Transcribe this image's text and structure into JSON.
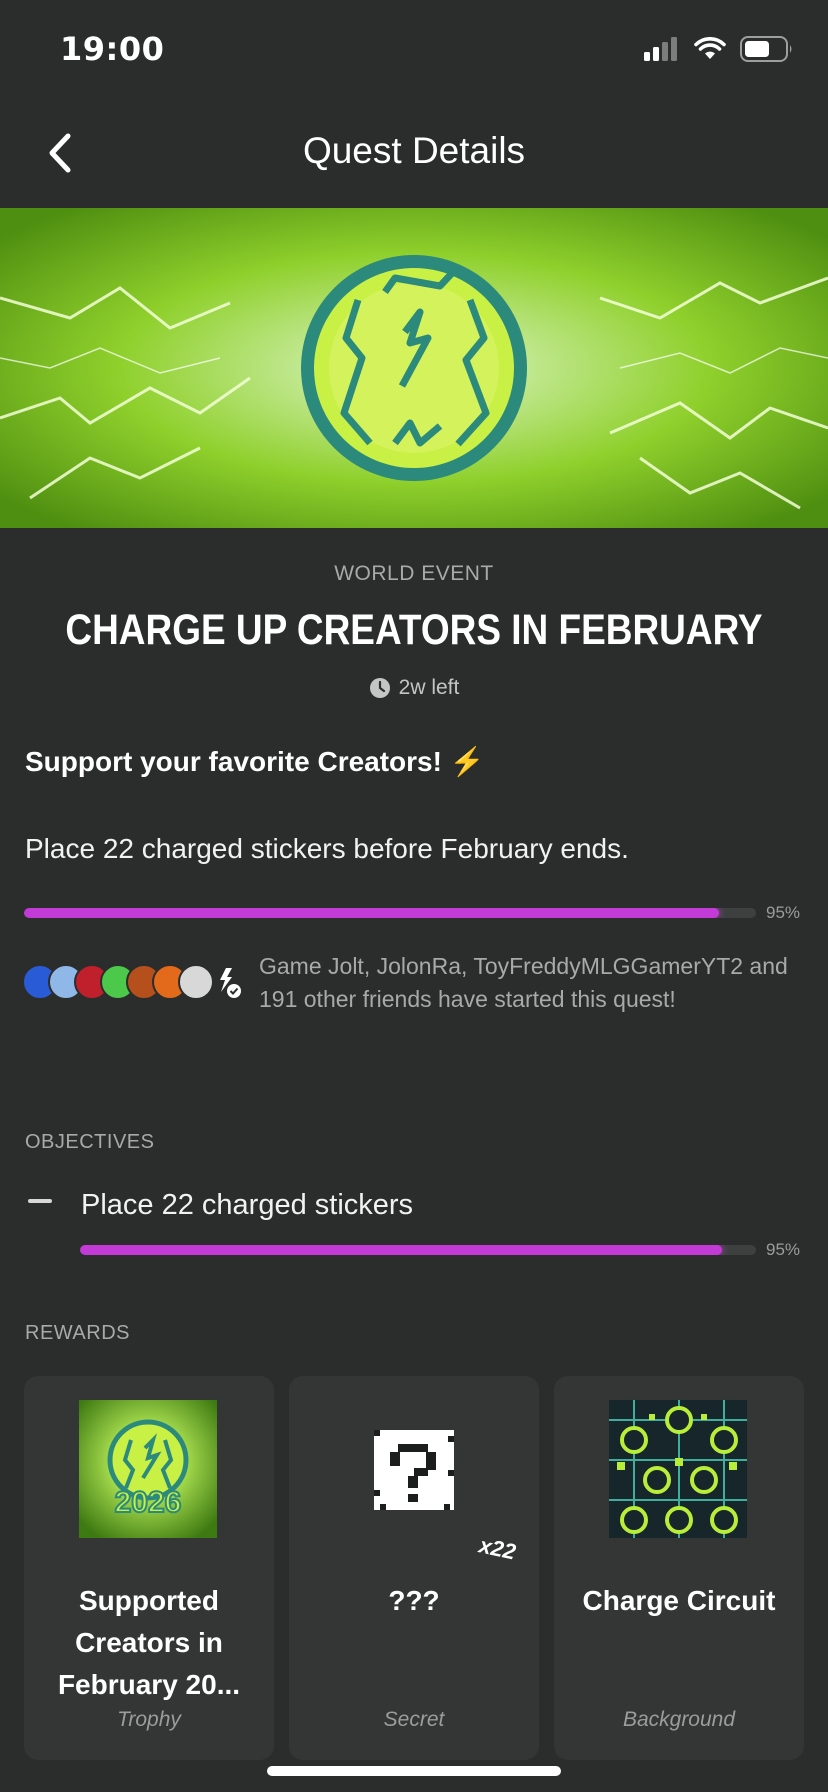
{
  "status_bar": {
    "time": "19:00",
    "signal_icon": "signal-icon",
    "wifi_icon": "wifi-icon",
    "battery_icon": "battery-icon"
  },
  "nav": {
    "back_icon": "chevron-left-icon",
    "title": "Quest Details"
  },
  "quest": {
    "event_type": "WORLD EVENT",
    "title": "CHARGE UP CREATORS IN FEBRUARY",
    "time_left": "2w left",
    "subtitle": "Support your favorite Creators! ⚡",
    "description": "Place 22 charged stickers before February ends.",
    "progress": 0.95,
    "progress_label": "95%"
  },
  "friends": {
    "text": "Game Jolt, JolonRa, ToyFreddyMLGGamerYT2 and 191 other friends have started this quest!",
    "avatar_colors": [
      "#2a5bd7",
      "#8fb8e8",
      "#c0202b",
      "#4cc94a",
      "#b5501d",
      "#e36a1b",
      "#d8d8d8",
      "#20242a"
    ]
  },
  "objectives": {
    "label": "OBJECTIVES",
    "items": [
      {
        "label": "Place 22 charged stickers",
        "progress": 0.95,
        "progress_label": "95%"
      }
    ]
  },
  "rewards": {
    "label": "REWARDS",
    "items": [
      {
        "name": "Supported Creators in February 20...",
        "kind": "Trophy",
        "image_text": "2026"
      },
      {
        "name": "???",
        "kind": "Secret",
        "multiplier": "x22"
      },
      {
        "name": "Charge Circuit",
        "kind": "Background"
      }
    ]
  },
  "colors": {
    "background": "#2a2d2c",
    "card": "#333635",
    "progress_fill": "#c33bd6",
    "accent_green": "#c6f03a"
  }
}
